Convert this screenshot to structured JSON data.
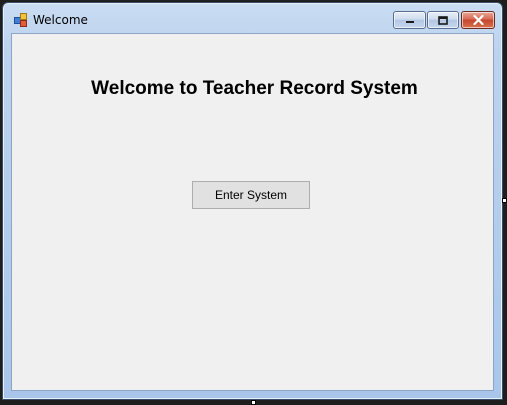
{
  "window": {
    "title": "Welcome",
    "app_icon": "form-icon",
    "controls": {
      "minimize_icon": "minimize-icon",
      "maximize_icon": "maximize-icon",
      "close_icon": "close-icon"
    }
  },
  "main": {
    "heading": "Welcome to Teacher Record System",
    "enter_button_label": "Enter System"
  },
  "colors": {
    "client_background": "#f0f0f0",
    "button_background": "#e1e1e1",
    "close_button": "#c4452d"
  }
}
